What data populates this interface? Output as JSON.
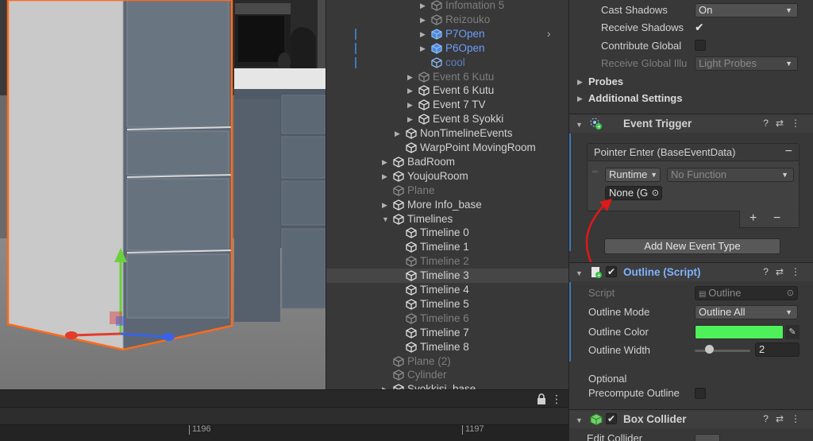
{
  "timeline": {
    "ticks": [
      "1196",
      "1197"
    ]
  },
  "hierarchy": {
    "rows": [
      {
        "label": "Infomation 5",
        "style": "dim",
        "indent": 4,
        "arrow": "▶"
      },
      {
        "label": "Reizouko",
        "style": "dim",
        "indent": 4,
        "arrow": "▶"
      },
      {
        "label": "P7Open",
        "style": "blue",
        "indent": 4,
        "arrow": "▶",
        "mark": true,
        "chevron": true
      },
      {
        "label": "P6Open",
        "style": "blue",
        "indent": 4,
        "arrow": "▶",
        "mark": true
      },
      {
        "label": "cool",
        "style": "dim-blue",
        "indent": 4,
        "arrow": "",
        "mark": true
      },
      {
        "label": "Event 6 Kutu",
        "style": "dim",
        "indent": 3,
        "arrow": "▶"
      },
      {
        "label": "Event 6 Kutu",
        "style": "",
        "indent": 3,
        "arrow": "▶"
      },
      {
        "label": "Event 7 TV",
        "style": "",
        "indent": 3,
        "arrow": "▶"
      },
      {
        "label": "Event 8 Syokki",
        "style": "",
        "indent": 3,
        "arrow": "▶"
      },
      {
        "label": "NonTimelineEvents",
        "style": "",
        "indent": 2,
        "arrow": "▶"
      },
      {
        "label": "WarpPoint MovingRoom",
        "style": "",
        "indent": 2,
        "arrow": ""
      },
      {
        "label": "BadRoom",
        "style": "",
        "indent": 1,
        "arrow": "▶"
      },
      {
        "label": "YoujouRoom",
        "style": "",
        "indent": 1,
        "arrow": "▶"
      },
      {
        "label": "Plane",
        "style": "dim",
        "indent": 1,
        "arrow": ""
      },
      {
        "label": "More Info_base",
        "style": "",
        "indent": 1,
        "arrow": "▶"
      },
      {
        "label": "Timelines",
        "style": "",
        "indent": 1,
        "arrow": "▼"
      },
      {
        "label": "Timeline 0",
        "style": "",
        "indent": 2,
        "arrow": ""
      },
      {
        "label": "Timeline 1",
        "style": "",
        "indent": 2,
        "arrow": ""
      },
      {
        "label": "Timeline 2",
        "style": "dim",
        "indent": 2,
        "arrow": ""
      },
      {
        "label": "Timeline 3",
        "style": "",
        "indent": 2,
        "arrow": "",
        "selected": true
      },
      {
        "label": "Timeline 4",
        "style": "",
        "indent": 2,
        "arrow": ""
      },
      {
        "label": "Timeline 5",
        "style": "",
        "indent": 2,
        "arrow": ""
      },
      {
        "label": "Timeline 6",
        "style": "dim",
        "indent": 2,
        "arrow": ""
      },
      {
        "label": "Timeline 7",
        "style": "",
        "indent": 2,
        "arrow": ""
      },
      {
        "label": "Timeline 8",
        "style": "",
        "indent": 2,
        "arrow": ""
      },
      {
        "label": "Plane (2)",
        "style": "dim",
        "indent": 1,
        "arrow": ""
      },
      {
        "label": "Cylinder",
        "style": "dim",
        "indent": 1,
        "arrow": ""
      },
      {
        "label": "Syokkisi_base",
        "style": "",
        "indent": 1,
        "arrow": "▶"
      }
    ]
  },
  "inspector": {
    "renderer": {
      "cast_shadows_label": "Cast Shadows",
      "cast_shadows_value": "On",
      "receive_shadows_label": "Receive Shadows",
      "receive_shadows_check": "✔",
      "contribute_gi_label": "Contribute Global",
      "receive_gi_label": "Receive Global Illu",
      "receive_gi_value": "Light Probes",
      "probes_label": "Probes",
      "additional_label": "Additional Settings"
    },
    "event_trigger": {
      "title": "Event Trigger",
      "entry_header": "Pointer Enter (BaseEventData)",
      "entry_remove": "−",
      "runtime_value": "Runtime",
      "function_value": "No Function",
      "object_value": "None (G",
      "plus": "+",
      "minus": "−",
      "add_button": "Add New Event Type"
    },
    "outline": {
      "title": "Outline (Script)",
      "script_label": "Script",
      "script_value": "Outline",
      "mode_label": "Outline Mode",
      "mode_value": "Outline All",
      "color_label": "Outline Color",
      "color_hex": "#4ef15a",
      "width_label": "Outline Width",
      "width_value": "2",
      "width_slider_fraction": 0.25,
      "optional_label": "Optional",
      "precompute_label": "Precompute Outline"
    },
    "box_collider": {
      "title": "Box Collider",
      "edit_label": "Edit Collider"
    }
  }
}
